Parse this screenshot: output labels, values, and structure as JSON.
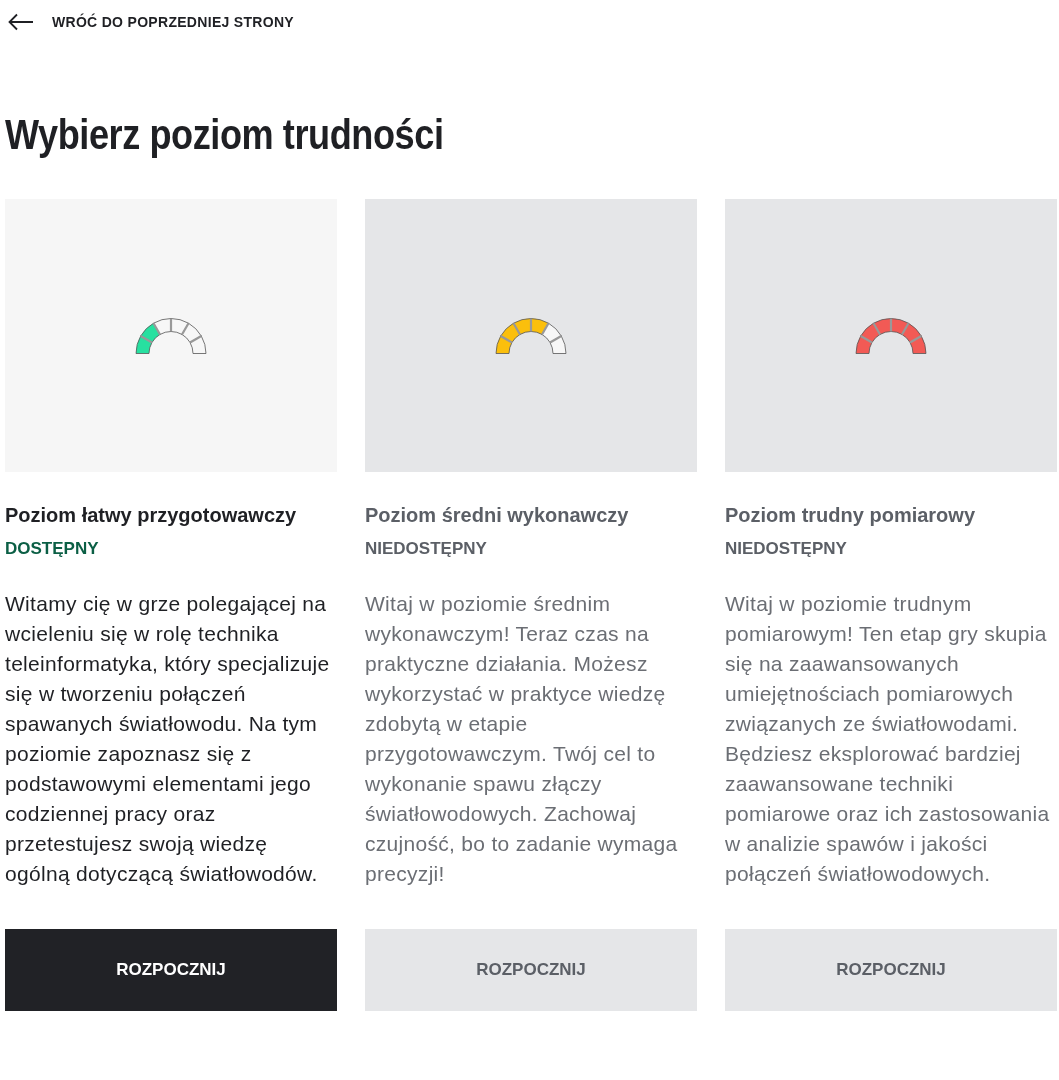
{
  "back_link": {
    "label": "WRÓĆ DO POPRZEDNIEJ STRONY"
  },
  "title": "Wybierz poziom trudności",
  "levels": [
    {
      "name": "Poziom łatwy przygotowawczy",
      "status": "DOSTĘPNY",
      "available": true,
      "kind": "easy",
      "color": "#27e0a0",
      "description": "Witamy cię w grze polegającej na wcieleniu się w rolę technika teleinformatyka, który specjalizuje się w tworzeniu połączeń spawanych światłowodu. Na tym poziomie zapoznasz się z podstawowymi elementami jego codziennej pracy oraz przetestujesz swoją wiedzę ogólną dotyczącą światłowodów.",
      "button": "ROZPOCZNIJ"
    },
    {
      "name": "Poziom średni wykonawczy",
      "status": "NIEDOSTĘPNY",
      "available": false,
      "kind": "medium",
      "color": "#fbbf0c",
      "description": "Witaj w poziomie średnim wykonawczym! Teraz czas na praktyczne działania. Możesz wykorzystać w praktyce wiedzę zdobytą w etapie przygotowawczym. Twój cel to wykonanie spawu złączy światłowodowych. Zachowaj czujność, bo to zadanie wymaga precyzji!",
      "button": "ROZPOCZNIJ"
    },
    {
      "name": "Poziom trudny pomiarowy",
      "status": "NIEDOSTĘPNY",
      "available": false,
      "kind": "hard",
      "color": "#f25a55",
      "description": "Witaj w poziomie trudnym pomiarowym! Ten etap gry skupia się na zaawansowanych umiejętnościach pomiarowych związanych ze światłowodami. Będziesz eksplorować bardziej zaawansowane techniki pomiarowe oraz ich zastosowania w analizie spawów i jakości połączeń światłowodowych.",
      "button": "ROZPOCZNIJ"
    }
  ]
}
